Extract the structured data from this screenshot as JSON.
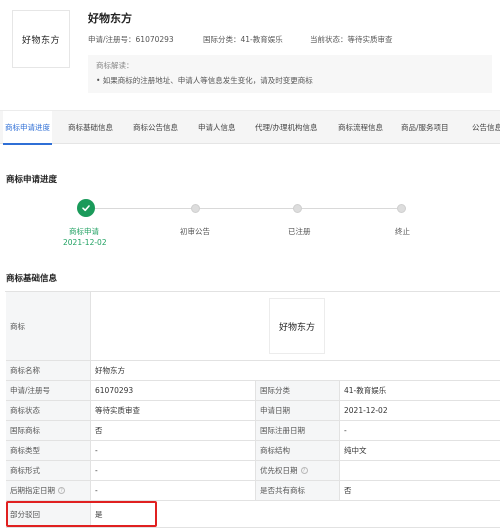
{
  "header": {
    "logo_text": "好物东方",
    "brand_name": "好物东方",
    "reg_no": "申请/注册号：61070293",
    "intl_class": "国际分类：41-教育娱乐",
    "status": "当前状态：等待实质审查",
    "note_title": "商标解读：",
    "note_text": "• 如果商标的注册地址、申请人等信息发生变化，请及时变更商标"
  },
  "tabs": [
    {
      "label": "商标申请进度",
      "active": true
    },
    {
      "label": "商标基础信息"
    },
    {
      "label": "商标公告信息"
    },
    {
      "label": "申请人信息"
    },
    {
      "label": "代理/办理机构信息"
    },
    {
      "label": "商标流程信息"
    },
    {
      "label": "商品/服务项目"
    },
    {
      "label": "公告信息"
    }
  ],
  "progress": {
    "title": "商标申请进度",
    "steps": [
      {
        "label": "商标申请",
        "date": "2021-12-02",
        "done": true
      },
      {
        "label": "初审公告",
        "done": false
      },
      {
        "label": "已注册",
        "done": false
      },
      {
        "label": "终止",
        "done": false
      }
    ]
  },
  "basic": {
    "title": "商标基础信息",
    "logo_label": "商标",
    "logo_text": "好物东方",
    "rows": [
      {
        "l1": "商标名称",
        "v1": "好物东方"
      },
      {
        "l1": "申请/注册号",
        "v1": "61070293",
        "l2": "国际分类",
        "v2": "41-教育娱乐"
      },
      {
        "l1": "商标状态",
        "v1": "等待实质审查",
        "l2": "申请日期",
        "v2": "2021-12-02"
      },
      {
        "l1": "国际商标",
        "v1": "否",
        "l2": "国际注册日期",
        "v2": "-"
      },
      {
        "l1": "商标类型",
        "v1": "-",
        "l2": "商标结构",
        "v2": "纯中文"
      },
      {
        "l1": "商标形式",
        "v1": "-",
        "l2": "优先权日期",
        "v2": ""
      },
      {
        "l1": "后期指定日期",
        "v1": "-",
        "l2": "是否共有商标",
        "v2": "否"
      },
      {
        "l1": "部分驳回",
        "v1": "是"
      }
    ]
  },
  "colors": {
    "accent": "#2f6fd6",
    "success": "#1a9a5a",
    "highlight": "#e02020"
  }
}
